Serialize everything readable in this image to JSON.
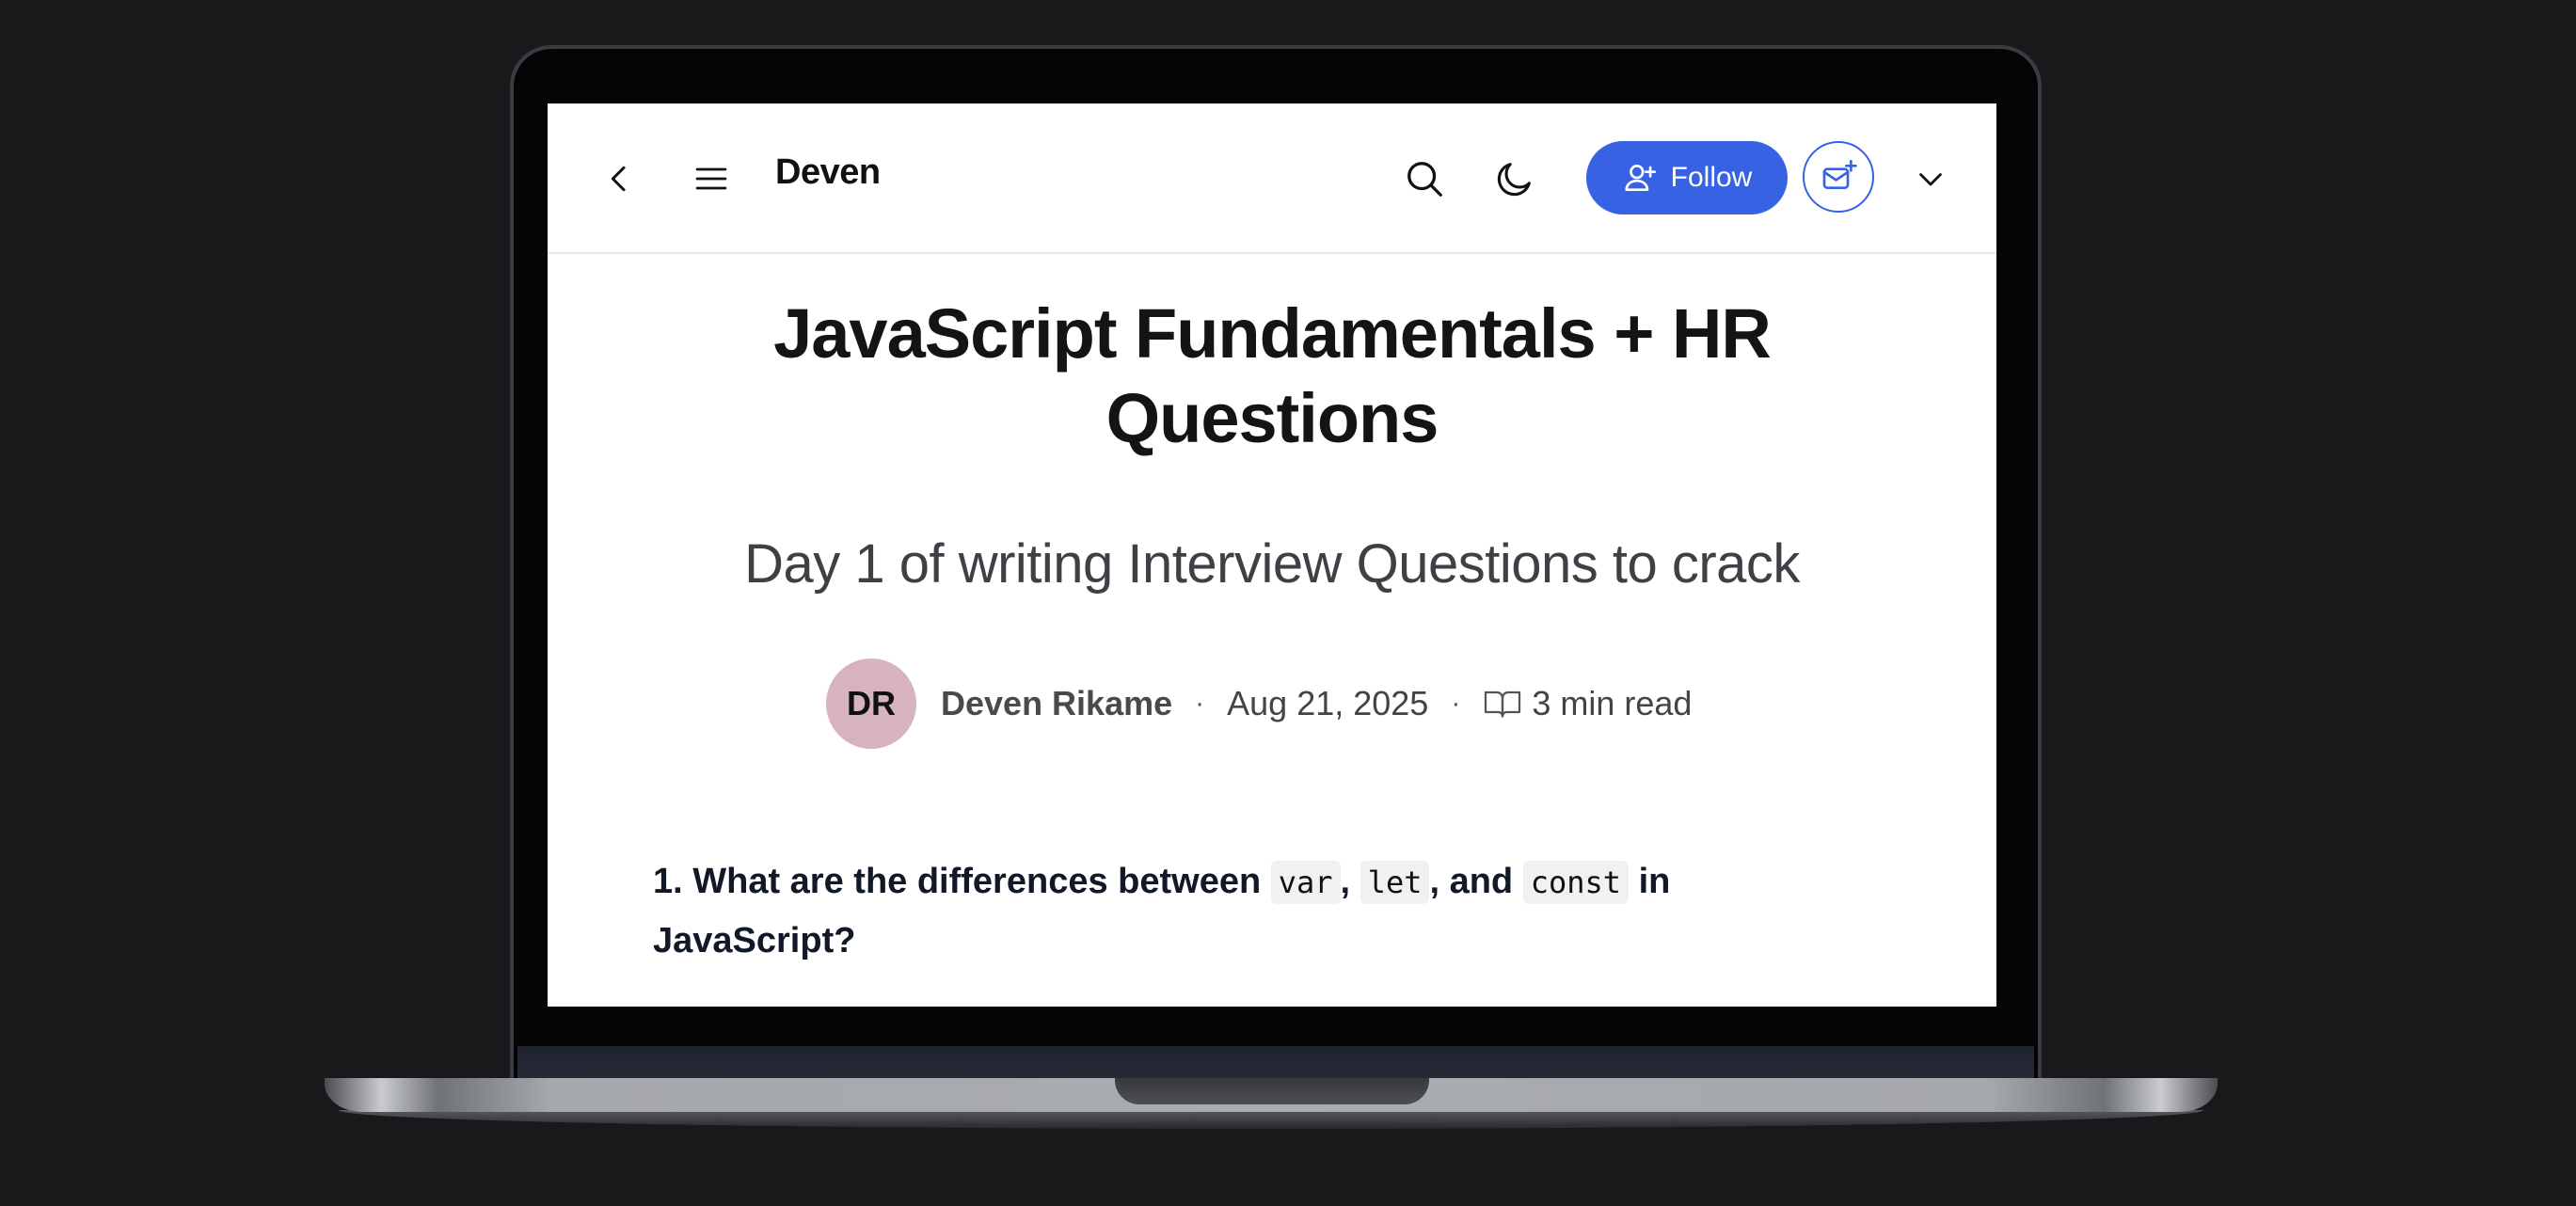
{
  "header": {
    "brand": "Deven",
    "follow_label": "Follow",
    "icons": [
      "back-icon",
      "menu-icon",
      "search-icon",
      "moon-icon",
      "user-plus-icon",
      "mail-plus-icon",
      "chevron-down-icon"
    ]
  },
  "article": {
    "title_line1": "JavaScript Fundamentals + HR",
    "title_line2": "Questions",
    "subtitle": "Day 1 of writing Interview Questions to crack",
    "author_initials": "DR",
    "author_name": "Deven Rikame",
    "date": "Aug 21, 2025",
    "read_time": "3 min read",
    "meta_separator": "·",
    "question": {
      "prefix": "1. What are the differences between",
      "code1": "var",
      "sep1": ",",
      "code2": "let",
      "sep2": ", and",
      "code3": "const",
      "suffix": "in",
      "line2": "JavaScript?"
    }
  },
  "colors": {
    "accent": "#3762e3",
    "avatar_bg": "#d7b2c0",
    "page_bg": "#19191b"
  }
}
